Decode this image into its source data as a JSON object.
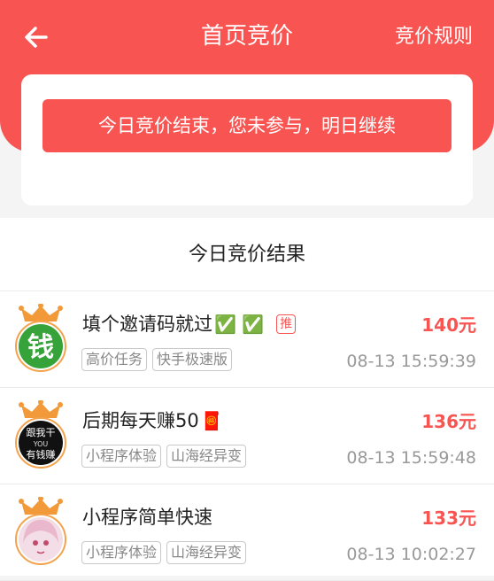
{
  "header": {
    "title": "首页竞价",
    "rules_link": "竞价规则",
    "back_icon": "arrow-left-icon",
    "color": "#f75452"
  },
  "status": {
    "message": "今日竞价结束，您未参与，明日继续"
  },
  "results": {
    "title": "今日竞价结果",
    "items": [
      {
        "title": "填个邀请码就过",
        "emoji": "✅ ✅",
        "badge": "推",
        "tags": [
          "高价任务",
          "快手极速版"
        ],
        "price": "140元",
        "time": "08-13 15:59:39",
        "avatar_icon": "money-character-avatar",
        "avatar_text": "钱"
      },
      {
        "title": "后期每天赚50",
        "emoji": "🧧",
        "tags": [
          "小程序体验",
          "山海经异变"
        ],
        "price": "136元",
        "time": "08-13 15:59:48",
        "avatar_icon": "text-avatar",
        "avatar_lines": [
          "跟我干",
          "YOU",
          "有钱赚"
        ]
      },
      {
        "title": "小程序简单快速",
        "tags": [
          "小程序体验",
          "山海经异变"
        ],
        "price": "133元",
        "time": "08-13 10:02:27",
        "avatar_icon": "anime-girl-avatar"
      }
    ]
  }
}
